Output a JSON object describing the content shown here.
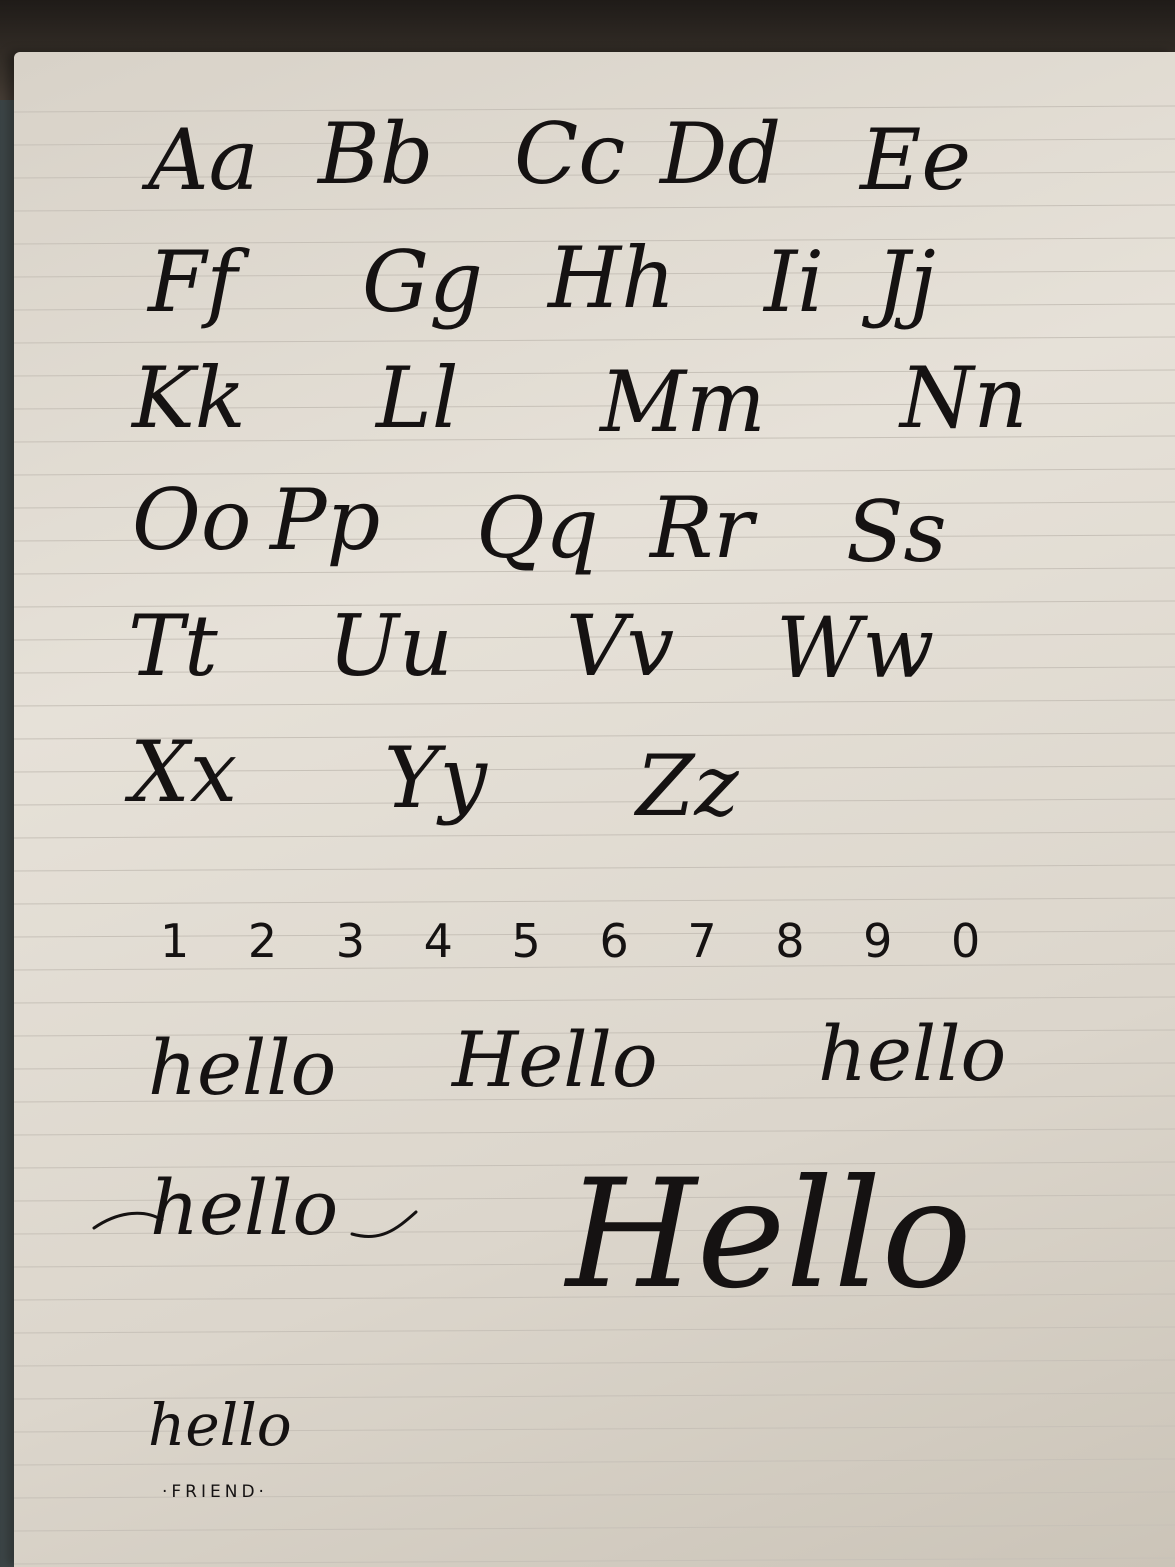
{
  "alphabet": {
    "row1": [
      "Aa",
      "Bb",
      "Cc",
      "Dd",
      "Ee"
    ],
    "row2": [
      "Ff",
      "Gg",
      "Hh",
      "Ii",
      "Jj"
    ],
    "row3": [
      "Kk",
      "Ll",
      "Mm",
      "Nn"
    ],
    "row4": [
      "Oo",
      "Pp",
      "Qq",
      "Rr",
      "Ss"
    ],
    "row5": [
      "Tt",
      "Uu",
      "Vv",
      "Ww"
    ],
    "row6": [
      "Xx",
      "Yy",
      "Zz"
    ]
  },
  "digits": "1 2 3 4 5 6 7 8 9 0",
  "words": {
    "hello_1": "hello",
    "hello_2": "Hello",
    "hello_3": "hello",
    "hello_flourish": "hello",
    "hello_large": "Hello",
    "hello_small": "hello",
    "friend": "·FRIEND·"
  },
  "colors": {
    "ink": "#151212",
    "paper": "#e2ddd3",
    "rule_line": "#c7c1b8"
  }
}
